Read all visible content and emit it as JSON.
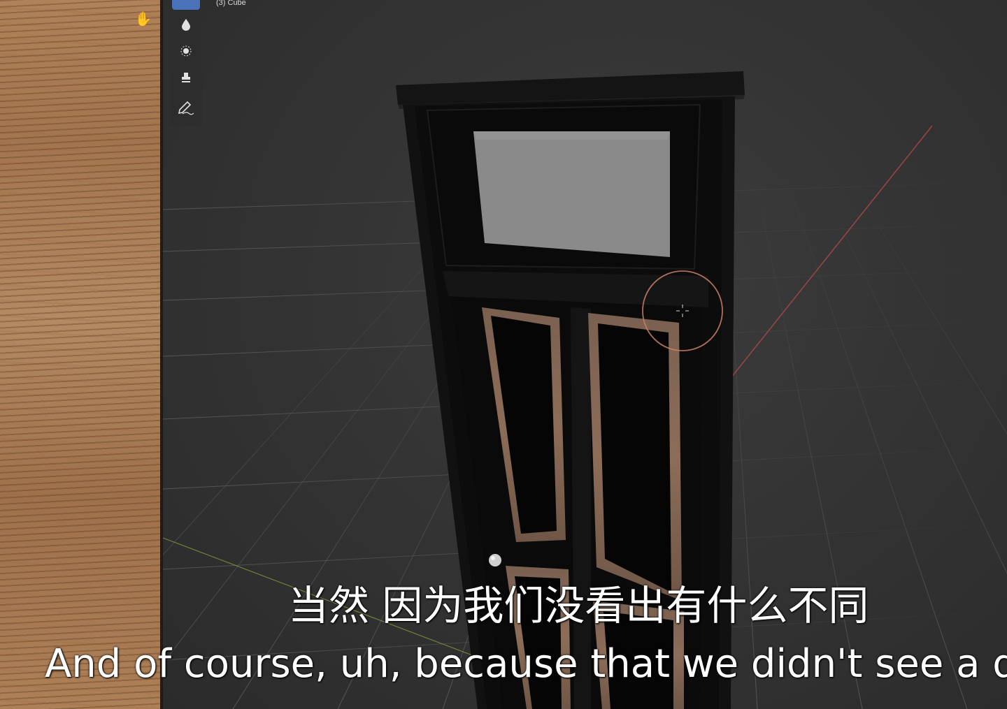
{
  "viewport": {
    "object_label": "(3) Cube"
  },
  "toolbar": {
    "tools": [
      {
        "name": "select-tool",
        "icon": "cursor-icon",
        "active": true
      },
      {
        "name": "draw-tool",
        "icon": "drop-icon"
      },
      {
        "name": "sample-tool",
        "icon": "dot-icon"
      },
      {
        "name": "clone-tool",
        "icon": "stamp-icon"
      },
      {
        "name": "annotate-tool",
        "icon": "pencil-icon"
      }
    ]
  },
  "subtitles": {
    "chinese": "当然 因为我们没看出有什么不同",
    "english": "And of course, uh, because that we didn't see a diff"
  },
  "colors": {
    "accent": "#4a72b8",
    "x_axis": "#b44a4a",
    "y_axis": "#8aa83a"
  }
}
